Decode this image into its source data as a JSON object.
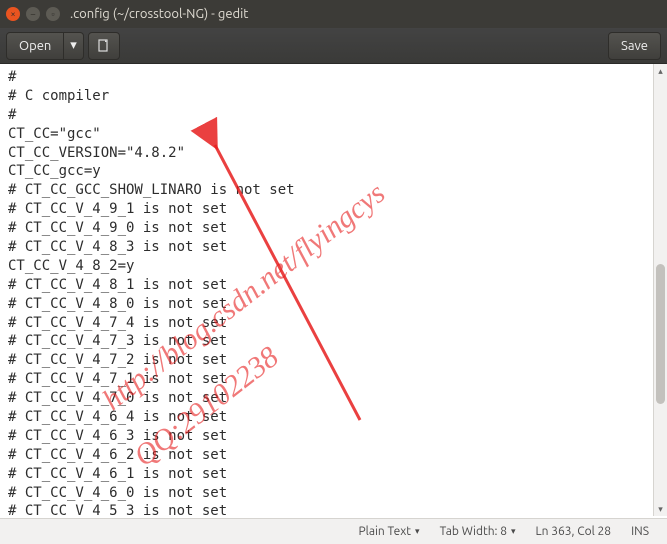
{
  "window": {
    "title": ".config (~/crosstool-NG) - gedit"
  },
  "toolbar": {
    "open_label": "Open",
    "save_label": "Save"
  },
  "editor": {
    "lines": [
      "#",
      "# C compiler",
      "#",
      "CT_CC=\"gcc\"",
      "CT_CC_VERSION=\"4.8.2\"",
      "CT_CC_gcc=y",
      "# CT_CC_GCC_SHOW_LINARO is not set",
      "# CT_CC_V_4_9_1 is not set",
      "# CT_CC_V_4_9_0 is not set",
      "# CT_CC_V_4_8_3 is not set",
      "CT_CC_V_4_8_2=y",
      "# CT_CC_V_4_8_1 is not set",
      "# CT_CC_V_4_8_0 is not set",
      "# CT_CC_V_4_7_4 is not set",
      "# CT_CC_V_4_7_3 is not set",
      "# CT_CC_V_4_7_2 is not set",
      "# CT_CC_V_4_7_1 is not set",
      "# CT_CC_V_4_7_0 is not set",
      "# CT_CC_V_4_6_4 is not set",
      "# CT_CC_V_4_6_3 is not set",
      "# CT_CC_V_4_6_2 is not set",
      "# CT_CC_V_4_6_1 is not set",
      "# CT_CC_V_4_6_0 is not set",
      "# CT_CC_V_4_5_3 is not set"
    ]
  },
  "statusbar": {
    "syntax": "Plain Text",
    "tabwidth": "Tab Width: 8",
    "cursor": "Ln 363, Col 28",
    "insert_mode": "INS"
  },
  "watermark": {
    "url": "http://blog.csdn.net/flyingcys",
    "qq": "QQ:29102238"
  }
}
